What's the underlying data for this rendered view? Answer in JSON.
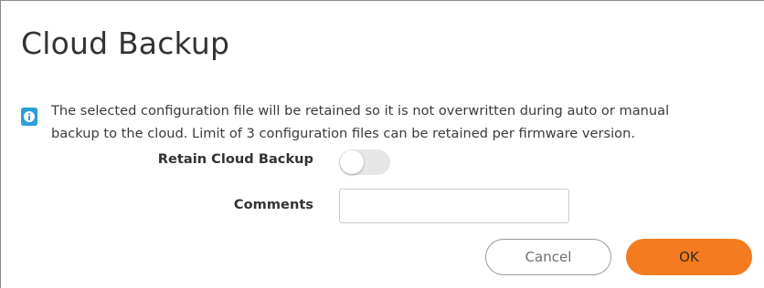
{
  "dialog": {
    "title": "Cloud Backup",
    "edge_glyph": "(",
    "info_icon": "info-icon",
    "info_line_1": "The selected configuration file will be retained so it is not overwritten during auto or manual",
    "info_line_2": "backup to the cloud. Limit of 3 configuration files can be retained per firmware version."
  },
  "form": {
    "retain_label": "Retain Cloud Backup",
    "retain_enabled": false,
    "comments_label": "Comments",
    "comments_value": "",
    "comments_placeholder": ""
  },
  "buttons": {
    "cancel_label": "Cancel",
    "ok_label": "OK"
  },
  "colors": {
    "info_icon": "#2b9fd9",
    "ok_button": "#f47b20",
    "toggle_off": "#e6e6e6"
  }
}
